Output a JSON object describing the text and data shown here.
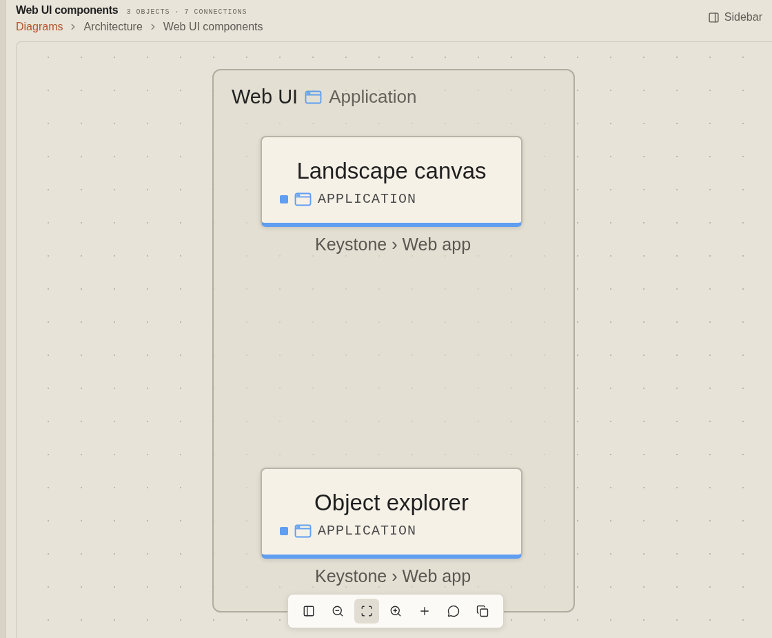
{
  "header": {
    "title": "Web UI components",
    "meta": "3 OBJECTS · 7 CONNECTIONS",
    "sidebar_button": "Sidebar"
  },
  "breadcrumbs": [
    {
      "label": "Diagrams",
      "link": true
    },
    {
      "label": "Architecture",
      "link": false
    },
    {
      "label": "Web UI components",
      "link": false
    }
  ],
  "group": {
    "title": "Web UI",
    "type": "Application"
  },
  "nodes": [
    {
      "title": "Landscape canvas",
      "type": "APPLICATION",
      "caption": "Keystone › Web app"
    },
    {
      "title": "Object explorer",
      "type": "APPLICATION",
      "caption": "Keystone › Web app"
    }
  ],
  "toolbar": [
    {
      "selected": false
    },
    {
      "selected": false
    },
    {
      "selected": true
    },
    {
      "selected": false
    },
    {
      "selected": false
    },
    {
      "selected": false
    },
    {
      "selected": false
    }
  ]
}
